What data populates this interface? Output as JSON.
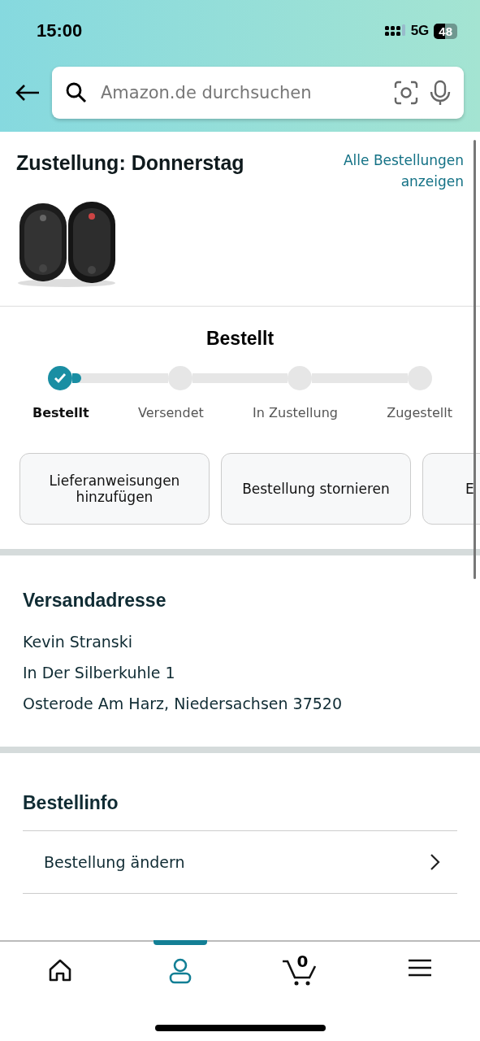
{
  "status_bar": {
    "time": "15:00",
    "network": "5G",
    "battery": "48"
  },
  "search": {
    "placeholder": "Amazon.de durchsuchen"
  },
  "delivery": {
    "title": "Zustellung: Donnerstag",
    "link": "Alle Bestellungen anzeigen"
  },
  "tracker": {
    "title": "Bestellt",
    "level": 0.03,
    "steps": [
      {
        "label": "Bestellt",
        "selected": true,
        "completed": true
      },
      {
        "label": "Versendet",
        "selected": false,
        "completed": false
      },
      {
        "label": "In Zustellung",
        "selected": false,
        "completed": false
      },
      {
        "label": "Zugestellt",
        "selected": false,
        "completed": false
      }
    ]
  },
  "actions": [
    "Lieferanweisungen hinzufügen",
    "Bestellung stornieren",
    "E"
  ],
  "address": {
    "title": "Versandadresse",
    "lines": [
      "Kevin Stranski",
      "In Der Silberkuhle 1",
      "Osterode Am Harz, Niedersachsen 37520"
    ]
  },
  "order_info": {
    "title": "Bestellinfo",
    "items": [
      "Bestellung ändern"
    ]
  },
  "nav": [
    {
      "kind": "home",
      "selected": false
    },
    {
      "kind": "account",
      "selected": true
    },
    {
      "kind": "cart",
      "count": "0",
      "selected": false
    },
    {
      "kind": "menu",
      "selected": false
    }
  ]
}
